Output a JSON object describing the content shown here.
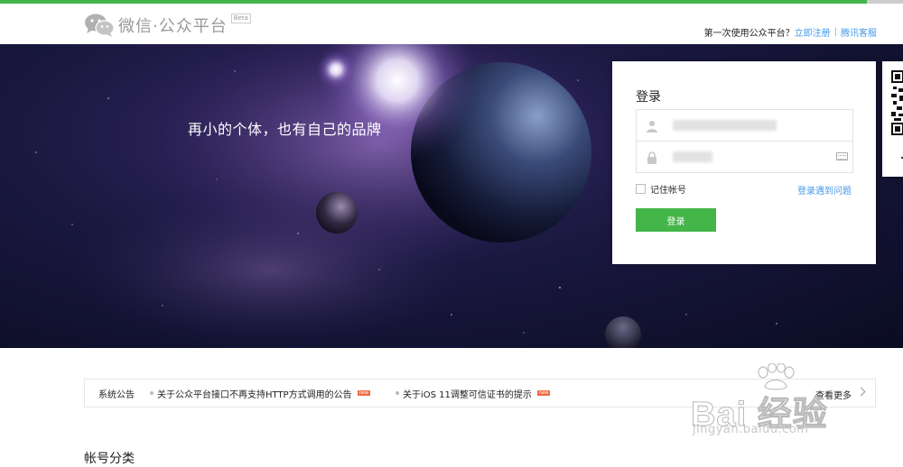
{
  "header": {
    "logo_icon": "wechat-icon",
    "title": "微信·公众平台",
    "beta": "Beta",
    "first_time_text": "第一次使用公众平台？",
    "register_link": "立即注册",
    "separator": "|",
    "support_link": "腾讯客服"
  },
  "banner": {
    "slogan": "再小的个体，也有自己的品牌"
  },
  "login": {
    "title": "登录",
    "account_icon": "user-icon",
    "password_icon": "lock-icon",
    "keyboard_icon": "keyboard-icon",
    "remember_label": "记住帐号",
    "help_link": "登录遇到问题",
    "submit_label": "登录"
  },
  "qr": {
    "icon": "qr-code-icon"
  },
  "notice": {
    "label": "系统公告",
    "items": [
      {
        "text": "关于公众平台接口不再支持HTTP方式调用的公告",
        "badge": "new"
      },
      {
        "text": "关于iOS 11调整可信证书的提示",
        "badge": "new"
      }
    ],
    "more_label": "查看更多"
  },
  "section": {
    "title": "帐号分类"
  },
  "watermark": {
    "text": "Bai 经验",
    "sub": "jingyan.baidu.com"
  },
  "colors": {
    "brand_green": "#44b549",
    "link_blue": "#459ae9",
    "badge_orange": "#f06b43"
  }
}
